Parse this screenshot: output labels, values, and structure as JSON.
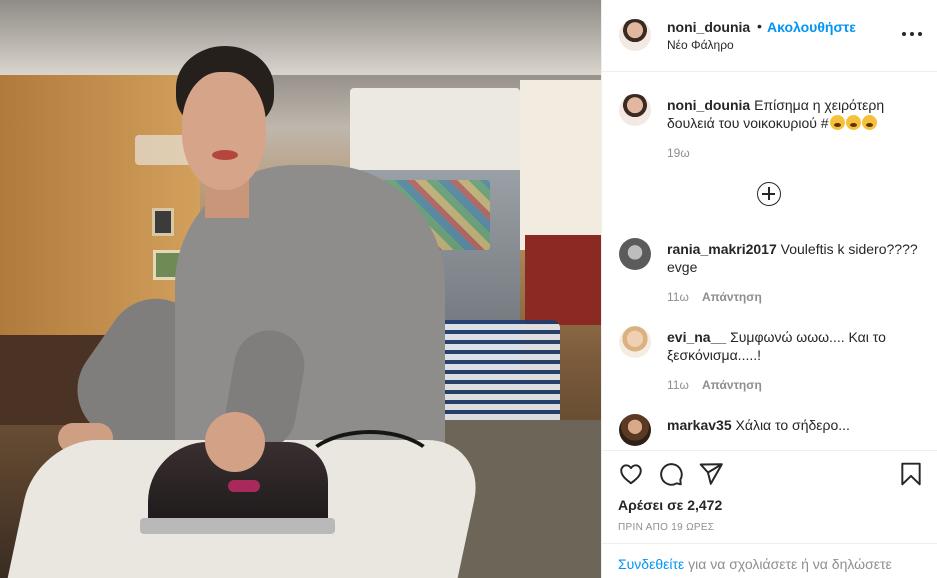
{
  "post": {
    "owner": "noni_dounia",
    "follow_label": "Ακολουθήστε",
    "separator": "•",
    "location": "Νέο Φάληρο",
    "caption": {
      "username": "noni_dounia",
      "text": "Επίσημα η χειρότερη δουλειά του νοικοκυριού #",
      "emoji_icon": "flushed-face-emoji",
      "time": "19ω"
    },
    "comments": [
      {
        "username": "rania_makri2017",
        "text": "Vouleftis k sidero???? evge",
        "time": "11ω",
        "reply_label": "Απάντηση"
      },
      {
        "username": "evi_na__",
        "text": "Συμφωνώ ωωω.... Και το ξεσκόνισμα.....!",
        "time": "11ω",
        "reply_label": "Απάντηση"
      },
      {
        "username": "markav35",
        "text": "Χάλια το σήδερο..."
      }
    ],
    "likes_prefix": "Αρέσει σε",
    "likes_count": "2,472",
    "posted_ago": "ΠΡΙΝ ΑΠΟ 19 ΩΡΕΣ"
  },
  "login_prompt": {
    "link": "Συνδεθείτε",
    "text": " για να σχολιάσετε ή να δηλώσετε"
  },
  "icons": {
    "more": "more-options-icon",
    "load_more": "plus-circle-icon",
    "like": "heart-icon",
    "comment": "comment-icon",
    "share": "paper-plane-icon",
    "save": "bookmark-icon"
  },
  "colors": {
    "link": "#0095f6",
    "text": "#262626",
    "muted": "#8e8e8e"
  }
}
